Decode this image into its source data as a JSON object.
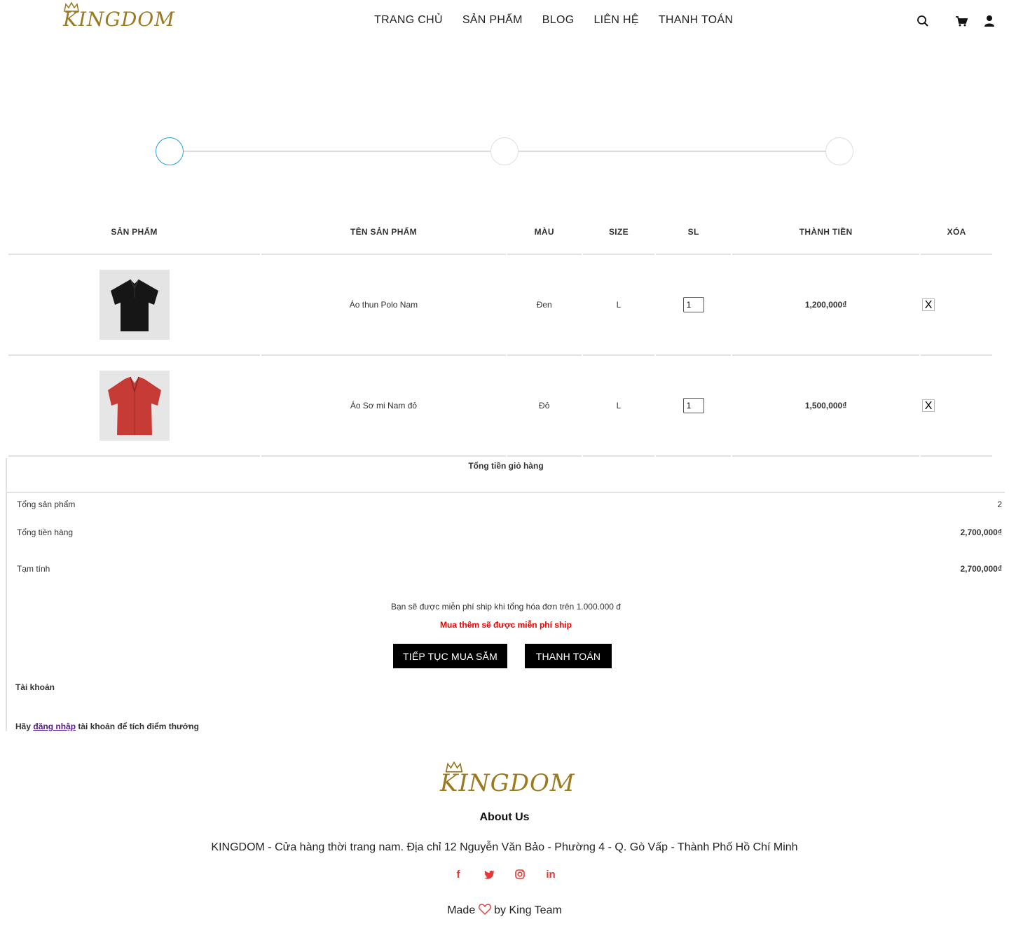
{
  "brand": {
    "name": "KINGDOM",
    "color": "#9c7a1f"
  },
  "nav": {
    "items": [
      {
        "label": "TRANG CHỦ"
      },
      {
        "label": "SẢN PHẨM"
      },
      {
        "label": "BLOG"
      },
      {
        "label": "LIÊN HỆ"
      },
      {
        "label": "THANH TOÁN"
      }
    ],
    "icons": [
      "search-icon",
      "cart-icon",
      "user-icon"
    ]
  },
  "steps": {
    "count": 3,
    "active_index": 0,
    "accent": "#28a3d6",
    "active_icon": ""
  },
  "cart": {
    "headers": {
      "image": "SẢN PHẨM",
      "name": "TÊN SẢN PHẨM",
      "color": "MÀU",
      "size": "SIZE",
      "qty": "SL",
      "total": "THÀNH TIỀN",
      "delete": "XÓA"
    },
    "rows": [
      {
        "name": "Áo thun Polo Nam",
        "color": "Đen",
        "size": "L",
        "qty": "1",
        "price": "1,200,000₫",
        "delete_label": "X",
        "image_icon": "black-polo-shirt"
      },
      {
        "name": "Áo Sơ mi Nam đỏ",
        "color": "Đỏ",
        "size": "L",
        "qty": "1",
        "price": "1,500,000₫",
        "delete_label": "X",
        "image_icon": "red-shirt"
      }
    ]
  },
  "summary": {
    "title": "Tổng tiền giỏ hàng",
    "items_label": "Tổng sản phẩm",
    "items_value": "2",
    "subtotal_label": "Tổng tiền hàng",
    "subtotal_value": "2,700,000₫",
    "provisional_label": "Tạm tính",
    "provisional_value": "2,700,000₫",
    "free_ship_note": "Bạn sẽ được miễn phí ship khi tổng hóa đơn trên 1.000.000 đ",
    "free_ship_alert": "Mua thêm sẽ được miễn phí ship",
    "continue_button": "TIẾP TỤC MUA SẮM",
    "checkout_button": "THANH TOÁN",
    "account_label": "Tài khoản",
    "login_prefix": "Hãy",
    "login_link": "đăng nhập",
    "login_suffix": "tài khoản để tích điểm thưởng"
  },
  "footer": {
    "about_title": "About Us",
    "address": "KINGDOM - Cửa hàng thời trang nam. Địa chỉ 12 Nguyễn Văn Bảo - Phường 4 - Q. Gò Vấp - Thành Phố Hồ Chí Minh",
    "social": [
      "facebook-icon",
      "twitter-icon",
      "instagram-icon",
      "linkedin-icon"
    ],
    "social_color": "#e53935",
    "made_prefix": "Made",
    "made_suffix": "by King Team"
  }
}
